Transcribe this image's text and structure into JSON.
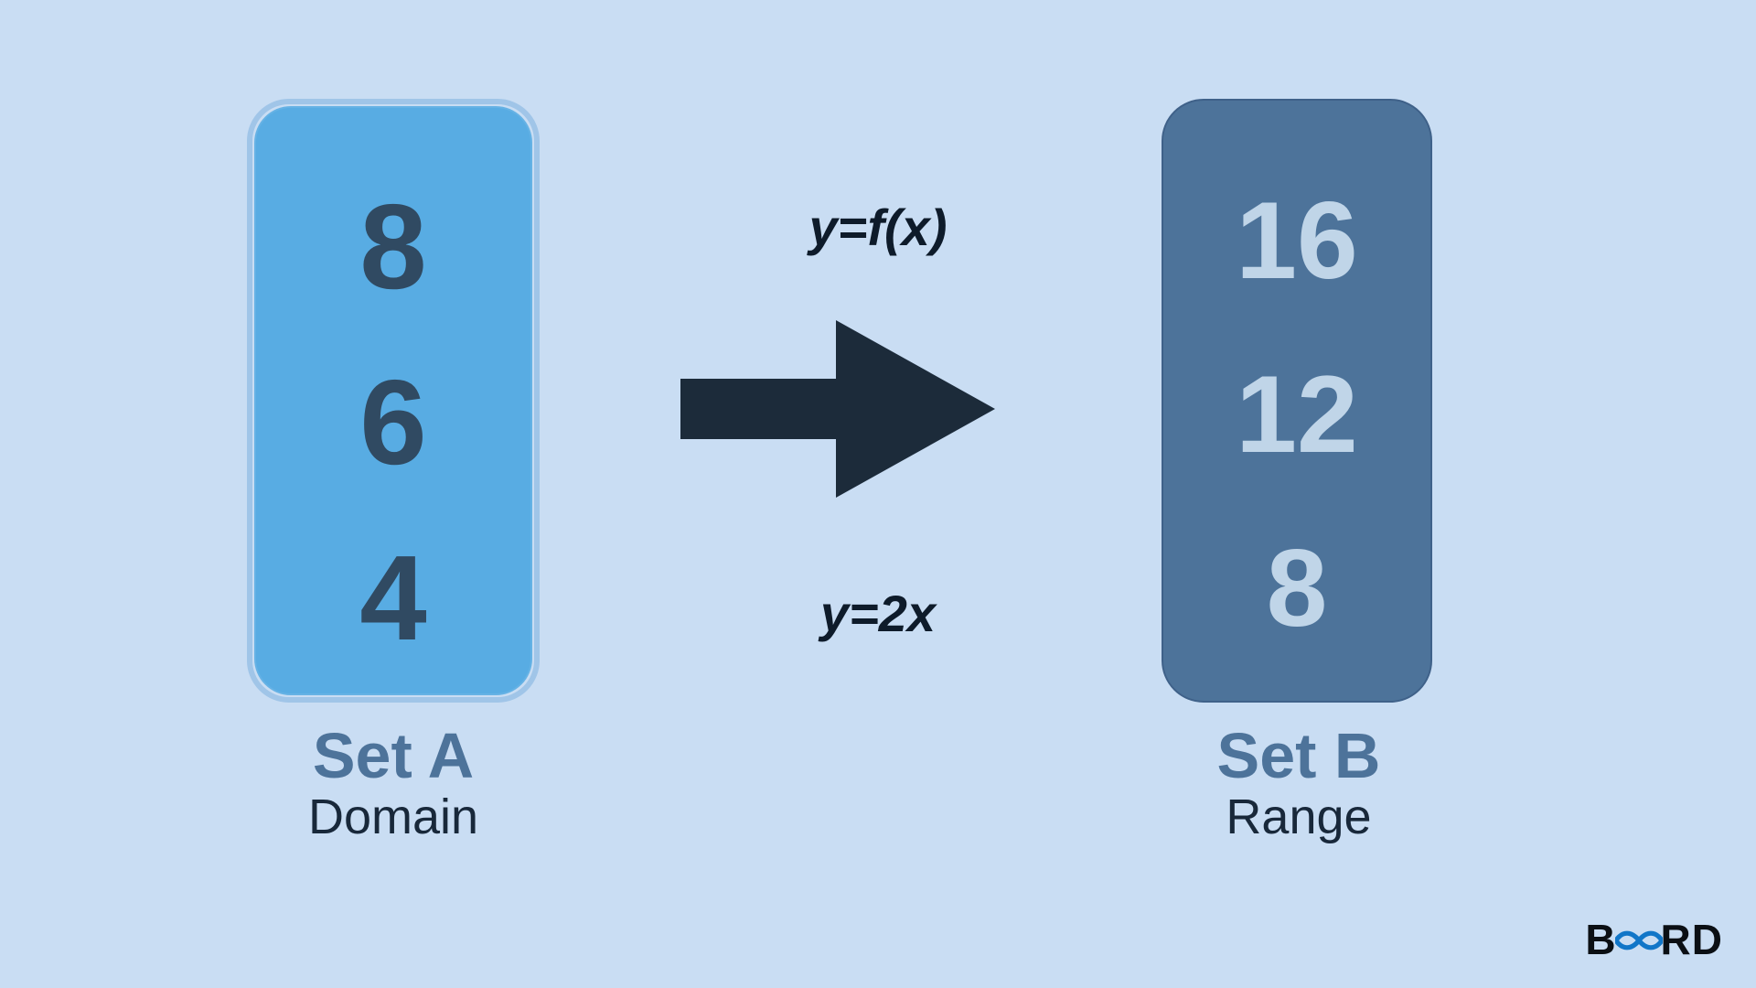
{
  "setA": {
    "title": "Set A",
    "subtitle": "Domain",
    "values": [
      "8",
      "6",
      "4"
    ]
  },
  "setB": {
    "title": "Set B",
    "subtitle": "Range",
    "values": [
      "16",
      "12",
      "8"
    ]
  },
  "equations": {
    "top": "y=f(x)",
    "bottom": "y=2x"
  },
  "logo": {
    "left": "B",
    "right": "RD"
  },
  "colors": {
    "bg": "#c9ddf3",
    "setA_fill": "#58ace3",
    "setA_text": "#304a62",
    "setB_fill": "#4d739a",
    "setB_text": "#c0d5e8",
    "arrow": "#1c2b3a",
    "logo_infinity": "#1176c8"
  }
}
